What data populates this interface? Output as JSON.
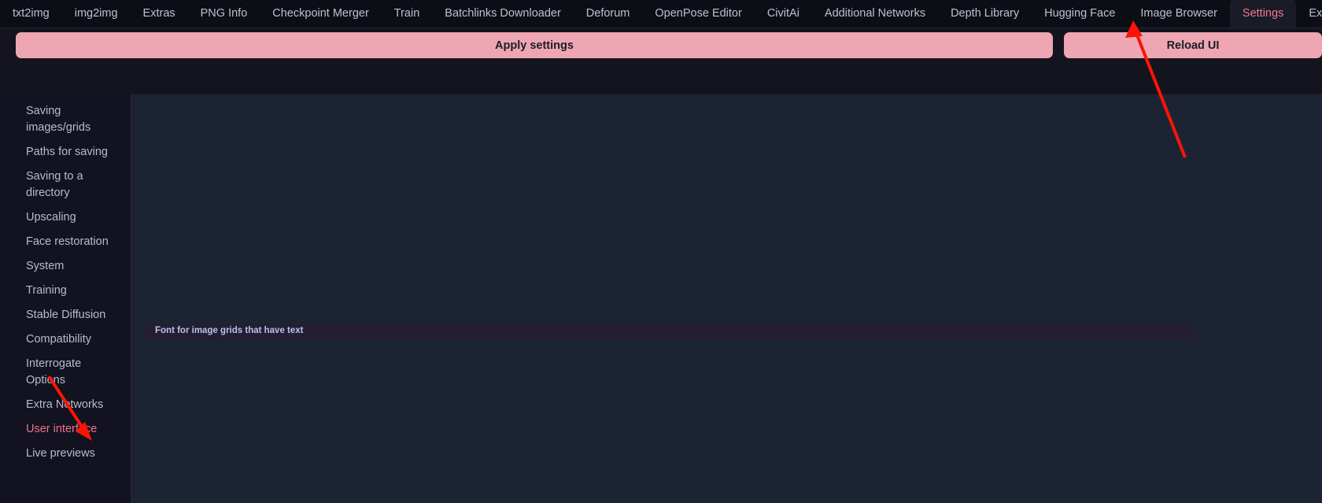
{
  "tabs": [
    {
      "label": "txt2img",
      "active": false
    },
    {
      "label": "img2img",
      "active": false
    },
    {
      "label": "Extras",
      "active": false
    },
    {
      "label": "PNG Info",
      "active": false
    },
    {
      "label": "Checkpoint Merger",
      "active": false
    },
    {
      "label": "Train",
      "active": false
    },
    {
      "label": "Batchlinks Downloader",
      "active": false
    },
    {
      "label": "Deforum",
      "active": false
    },
    {
      "label": "OpenPose Editor",
      "active": false
    },
    {
      "label": "CivitAi",
      "active": false
    },
    {
      "label": "Additional Networks",
      "active": false
    },
    {
      "label": "Depth Library",
      "active": false
    },
    {
      "label": "Hugging Face",
      "active": false
    },
    {
      "label": "Image Browser",
      "active": false
    },
    {
      "label": "Settings",
      "active": true
    },
    {
      "label": "Extensions",
      "active": false
    }
  ],
  "actions": {
    "apply_label": "Apply settings",
    "reload_label": "Reload UI"
  },
  "sidebar": {
    "items": [
      {
        "label": "Saving\nimages/grids",
        "active": false
      },
      {
        "label": "Paths for saving",
        "active": false
      },
      {
        "label": "Saving to a\ndirectory",
        "active": false
      },
      {
        "label": "Upscaling",
        "active": false
      },
      {
        "label": "Face restoration",
        "active": false
      },
      {
        "label": "System",
        "active": false
      },
      {
        "label": "Training",
        "active": false
      },
      {
        "label": "Stable Diffusion",
        "active": false
      },
      {
        "label": "Compatibility",
        "active": false
      },
      {
        "label": "Interrogate\nOptions",
        "active": false
      },
      {
        "label": "Extra Networks",
        "active": false
      },
      {
        "label": "User interface",
        "active": true
      },
      {
        "label": "Live previews",
        "active": false
      }
    ]
  },
  "panel": {
    "setting_label": "Font for image grids that have text"
  },
  "annotations": {
    "arrow_color": "#fb1405",
    "arrow_to_settings_tab": "arrow-pointing-to-settings-tab",
    "arrow_to_user_interface": "arrow-pointing-to-user-interface-item"
  },
  "colors": {
    "accent_pink": "#eda6b2",
    "active_text": "#f0718c",
    "tabbar_bg": "#0d0d16",
    "panel_bg": "#1c2433",
    "sidebar_bg": "#121221"
  }
}
